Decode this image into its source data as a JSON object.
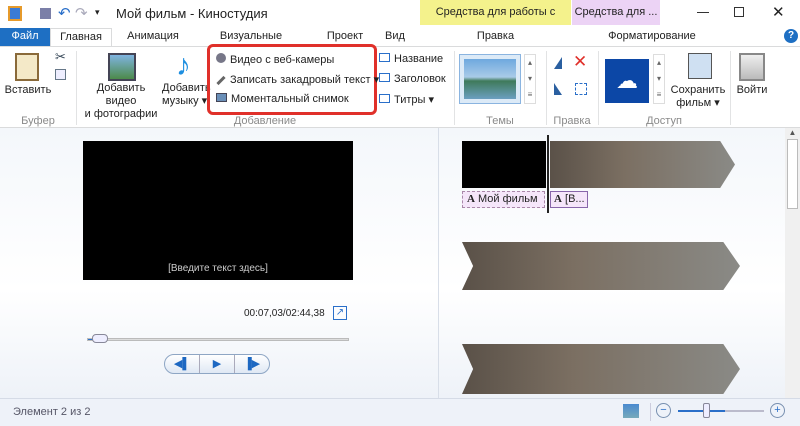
{
  "title": "Мой фильм - Киностудия",
  "context_tabs": {
    "video_tools": "Средства для работы с видео",
    "text_tools": "Средства для ...",
    "edit": "Правка",
    "format": "Форматирование"
  },
  "tabs": [
    "Файл",
    "Главная",
    "Анимация",
    "Визуальные эффекты",
    "Проект",
    "Вид"
  ],
  "ribbon": {
    "paste": "Вставить",
    "clipboard_group": "Буфер",
    "add_video_1": "Добавить видео",
    "add_video_2": "и фотографии",
    "add_music_1": "Добавить",
    "add_music_2": "музыку",
    "webcam": "Видео с веб-камеры",
    "narration": "Записать закадровый текст",
    "snapshot": "Моментальный снимок",
    "title_btn": "Название",
    "caption": "Заголовок",
    "credits": "Титры",
    "add_group": "Добавление",
    "themes_group": "Темы автофильма",
    "edit_group": "Правка",
    "save_1": "Сохранить",
    "save_2": "фильм",
    "share_group": "Доступ",
    "signin": "Войти"
  },
  "preview": {
    "placeholder": "[Введите текст здесь]",
    "time": "00:07,03/02:44,38",
    "progress": 0.04
  },
  "timeline": {
    "caption1": "Мой фильм",
    "caption2": "[В..."
  },
  "status": {
    "text": "Элемент 2 из 2",
    "zoom": 0.55
  },
  "colors": {
    "file_tab": "#1e6fc3",
    "highlight": "#e0302a",
    "video_tools": "#f4f28c",
    "text_tools": "#ecd3f5"
  }
}
